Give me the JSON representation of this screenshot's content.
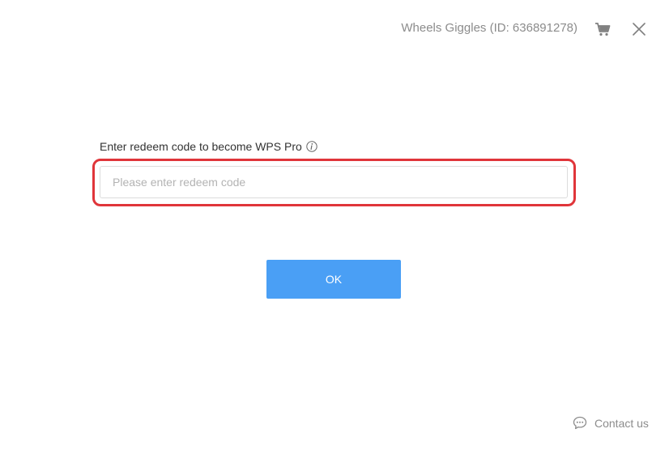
{
  "header": {
    "user_label": "Wheels Giggles (ID: 636891278)",
    "cart_icon": "cart-icon",
    "close_icon": "close-icon"
  },
  "redeem": {
    "prompt": "Enter redeem code to become WPS Pro",
    "info_icon": "info-icon",
    "input_value": "",
    "input_placeholder": "Please enter redeem code",
    "highlight_color": "#e0353a"
  },
  "actions": {
    "ok_label": "OK",
    "ok_color": "#4a9ff5"
  },
  "footer": {
    "contact_label": "Contact us",
    "contact_icon": "chat-bubble-icon"
  }
}
